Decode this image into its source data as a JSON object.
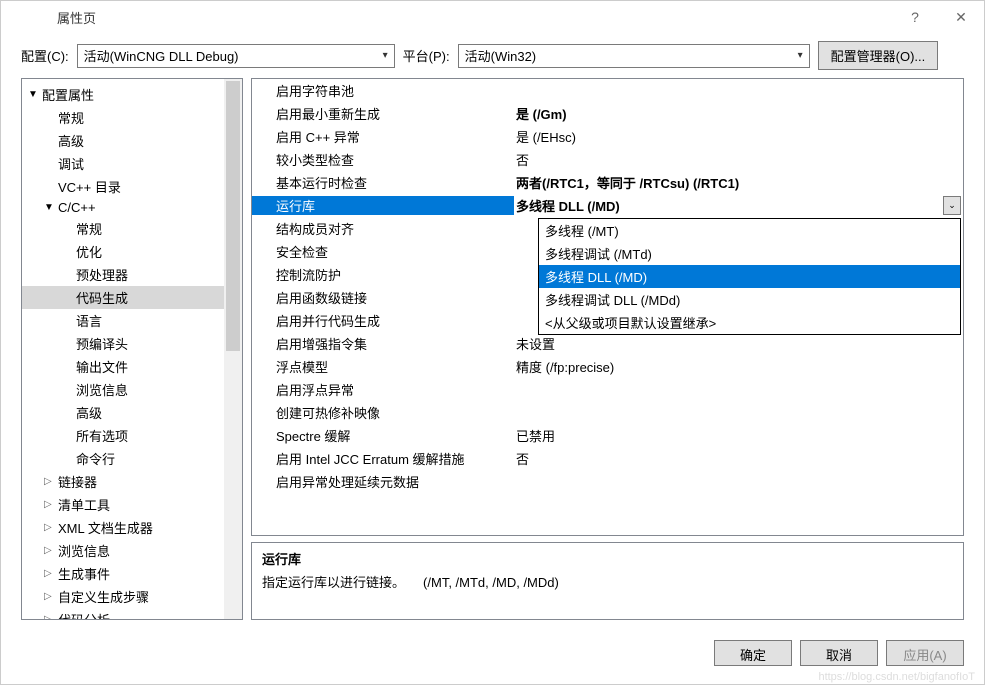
{
  "title": "属性页",
  "config_label": "配置(C):",
  "config_value": "活动(WinCNG DLL Debug)",
  "platform_label": "平台(P):",
  "platform_value": "活动(Win32)",
  "config_manager_btn": "配置管理器(O)...",
  "tree": [
    {
      "label": "配置属性",
      "depth": 0,
      "arrow": "▼",
      "open": true
    },
    {
      "label": "常规",
      "depth": 1
    },
    {
      "label": "高级",
      "depth": 1
    },
    {
      "label": "调试",
      "depth": 1
    },
    {
      "label": "VC++ 目录",
      "depth": 1
    },
    {
      "label": "C/C++",
      "depth": 1,
      "arrow": "▼",
      "open": true
    },
    {
      "label": "常规",
      "depth": 2
    },
    {
      "label": "优化",
      "depth": 2
    },
    {
      "label": "预处理器",
      "depth": 2
    },
    {
      "label": "代码生成",
      "depth": 2,
      "selected": true
    },
    {
      "label": "语言",
      "depth": 2
    },
    {
      "label": "预编译头",
      "depth": 2
    },
    {
      "label": "输出文件",
      "depth": 2
    },
    {
      "label": "浏览信息",
      "depth": 2
    },
    {
      "label": "高级",
      "depth": 2
    },
    {
      "label": "所有选项",
      "depth": 2
    },
    {
      "label": "命令行",
      "depth": 2
    },
    {
      "label": "链接器",
      "depth": 1,
      "arrow": "▷"
    },
    {
      "label": "清单工具",
      "depth": 1,
      "arrow": "▷"
    },
    {
      "label": "XML 文档生成器",
      "depth": 1,
      "arrow": "▷"
    },
    {
      "label": "浏览信息",
      "depth": 1,
      "arrow": "▷"
    },
    {
      "label": "生成事件",
      "depth": 1,
      "arrow": "▷"
    },
    {
      "label": "自定义生成步骤",
      "depth": 1,
      "arrow": "▷"
    },
    {
      "label": "代码分析",
      "depth": 1,
      "arrow": "▷"
    }
  ],
  "props": [
    {
      "label": "启用字符串池",
      "value": ""
    },
    {
      "label": "启用最小重新生成",
      "value": "是 (/Gm)",
      "bold": true
    },
    {
      "label": "启用 C++ 异常",
      "value": "是 (/EHsc)"
    },
    {
      "label": "较小类型检查",
      "value": "否"
    },
    {
      "label": "基本运行时检查",
      "value": "两者(/RTC1，等同于 /RTCsu) (/RTC1)",
      "bold": true
    },
    {
      "label": "运行库",
      "value": "多线程 DLL (/MD)",
      "selected": true
    },
    {
      "label": "结构成员对齐",
      "value": ""
    },
    {
      "label": "安全检查",
      "value": ""
    },
    {
      "label": "控制流防护",
      "value": ""
    },
    {
      "label": "启用函数级链接",
      "value": ""
    },
    {
      "label": "启用并行代码生成",
      "value": ""
    },
    {
      "label": "启用增强指令集",
      "value": "未设置"
    },
    {
      "label": "浮点模型",
      "value": "精度 (/fp:precise)"
    },
    {
      "label": "启用浮点异常",
      "value": ""
    },
    {
      "label": "创建可热修补映像",
      "value": ""
    },
    {
      "label": "Spectre 缓解",
      "value": "已禁用"
    },
    {
      "label": "启用 Intel JCC Erratum 缓解措施",
      "value": "否"
    },
    {
      "label": "启用异常处理延续元数据",
      "value": ""
    }
  ],
  "dropdown": [
    {
      "label": "多线程 (/MT)"
    },
    {
      "label": "多线程调试 (/MTd)"
    },
    {
      "label": "多线程 DLL (/MD)",
      "highlighted": true
    },
    {
      "label": "多线程调试 DLL (/MDd)"
    },
    {
      "label": "<从父级或项目默认设置继承>"
    }
  ],
  "desc": {
    "title": "运行库",
    "text": "指定运行库以进行链接。     (/MT, /MTd, /MD, /MDd)"
  },
  "buttons": {
    "ok": "确定",
    "cancel": "取消",
    "apply": "应用(A)"
  },
  "watermark": "https://blog.csdn.net/bigfanofIoT"
}
